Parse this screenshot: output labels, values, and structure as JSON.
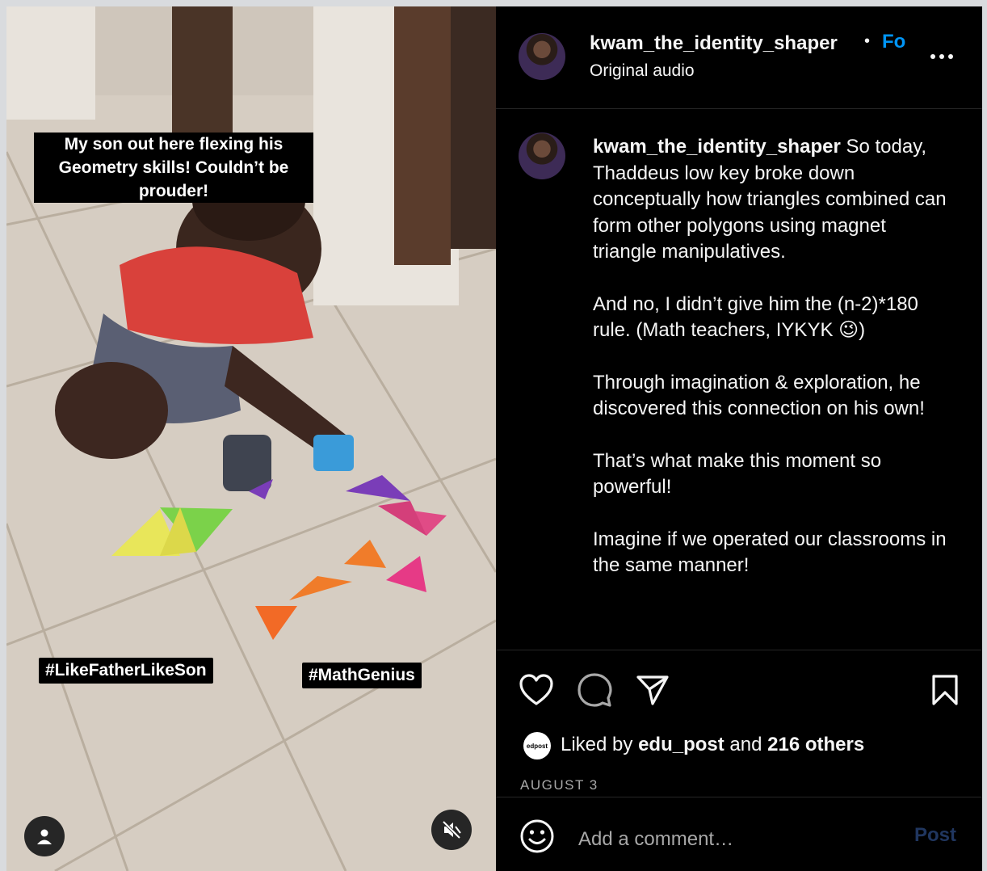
{
  "video": {
    "overlay_text": "My son out here flexing his Geometry skills!  Couldn’t be prouder!",
    "tag_left": "#LikeFatherLikeSon",
    "tag_right": "#MathGenius",
    "user_icon": "person-icon",
    "mute_icon": "speaker-muted-icon"
  },
  "header": {
    "username": "kwam_the_identity_shaper",
    "separator": "•",
    "follow_label": "Fo",
    "audio_label": "Original audio",
    "more_icon": "more-horizontal-icon"
  },
  "caption": {
    "username": "kwam_the_identity_shaper",
    "paragraph1": "So today, Thaddeus low key broke down conceptually how triangles combined can form other polygons using magnet triangle manipulatives.",
    "paragraph2": "And no, I didn’t give him the (n-2)*180 rule. (Math teachers, IYKYK 😉)",
    "paragraph3": "Through imagination & exploration, he discovered this connection on his own!",
    "paragraph4": "That’s what make this moment so powerful!",
    "paragraph5": "Imagine if we operated our classrooms in the same manner!"
  },
  "actions": {
    "like_icon": "heart-icon",
    "comment_icon": "comment-bubble-icon",
    "share_icon": "paper-plane-icon",
    "save_icon": "bookmark-icon"
  },
  "likes": {
    "avatar_text": "edpost",
    "prefix": "Liked by",
    "user": "edu_post",
    "conjunction": "and",
    "others": "216 others"
  },
  "date": "AUGUST 3",
  "comment": {
    "emoji_icon": "smiley-icon",
    "placeholder": "Add a comment…",
    "post_label": "Post"
  },
  "colors": {
    "panel_bg": "#000000",
    "follow_blue": "#0095f6",
    "post_disabled": "#20365f",
    "muted_text": "#a8a8a8"
  }
}
